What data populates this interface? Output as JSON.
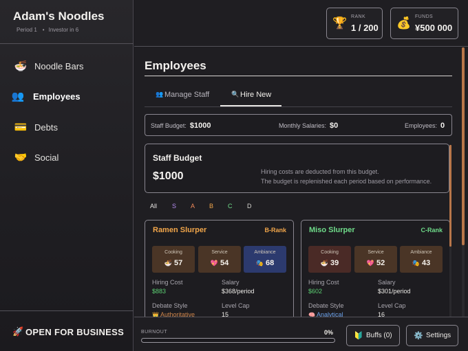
{
  "app": {
    "title": "Adam's Noodles",
    "period": "Period 1",
    "investor": "Investor in 6"
  },
  "sidebar": {
    "items": [
      {
        "label": "Noodle Bars",
        "icon": "noodle-bowl-icon",
        "glyph": "🍜"
      },
      {
        "label": "Employees",
        "icon": "people-icon",
        "glyph": "👥",
        "active": true
      },
      {
        "label": "Debts",
        "icon": "credit-card-icon",
        "glyph": "💳"
      },
      {
        "label": "Social",
        "icon": "handshake-icon",
        "glyph": "🤝"
      }
    ],
    "open_button": {
      "label": "OPEN FOR BUSINESS",
      "icon": "rocket-icon",
      "glyph": "🚀"
    }
  },
  "topbar": {
    "rank": {
      "caption": "RANK",
      "value": "1 / 200",
      "icon": "trophy-icon",
      "glyph": "🏆"
    },
    "funds": {
      "caption": "FUNDS",
      "value": "¥500 000",
      "icon": "money-bag-icon",
      "glyph": "💰"
    }
  },
  "main": {
    "title": "Employees",
    "tabs": [
      {
        "label": "Manage Staff",
        "icon": "people-icon",
        "glyph": "👥"
      },
      {
        "label": "Hire New",
        "icon": "magnifier-icon",
        "glyph": "🔍",
        "active": true
      }
    ],
    "summary": {
      "staff_budget_label": "Staff Budget:",
      "staff_budget_value": "$1000",
      "monthly_salaries_label": "Monthly Salaries:",
      "monthly_salaries_value": "$0",
      "employees_label": "Employees:",
      "employees_value": "0"
    },
    "budget_card": {
      "title": "Staff Budget",
      "amount": "$1000",
      "note_line1": "Hiring costs are deducted from this budget.",
      "note_line2": "The budget is replenished each period based on performance."
    },
    "filters": [
      {
        "label": "All",
        "color": "#e8e6e3"
      },
      {
        "label": "S",
        "color": "#b58cf0"
      },
      {
        "label": "A",
        "color": "#f08a5a"
      },
      {
        "label": "B",
        "color": "#f2a64a"
      },
      {
        "label": "C",
        "color": "#6fdc8a"
      },
      {
        "label": "D",
        "color": "#d8d6d2"
      }
    ],
    "candidates": [
      {
        "name": "Ramen Slurper",
        "name_color": "#f2a64a",
        "rank": "B-Rank",
        "rank_color": "#f2a64a",
        "skills": [
          {
            "caption": "Cooking",
            "value": "57",
            "glyph": "🍜",
            "icon": "noodle-bowl-icon",
            "bg": "#4a3526"
          },
          {
            "caption": "Service",
            "value": "54",
            "glyph": "💖",
            "icon": "heart-icon",
            "bg": "#4a3526"
          },
          {
            "caption": "Ambiance",
            "value": "68",
            "glyph": "🎭",
            "icon": "theater-masks-icon",
            "bg": "#2c3a6e"
          }
        ],
        "hiring_cost_label": "Hiring Cost",
        "hiring_cost": "$883",
        "salary_label": "Salary",
        "salary": "$368/period",
        "debate_label": "Debate Style",
        "debate_style": "Authoritative",
        "debate_glyph": "👑",
        "debate_color": "#d0864a",
        "level_cap_label": "Level Cap",
        "level_cap": "15"
      },
      {
        "name": "Miso Slurper",
        "name_color": "#6fdc8a",
        "rank": "C-Rank",
        "rank_color": "#6fdc8a",
        "skills": [
          {
            "caption": "Cooking",
            "value": "39",
            "glyph": "🍜",
            "icon": "noodle-bowl-icon",
            "bg": "#4a2a26"
          },
          {
            "caption": "Service",
            "value": "52",
            "glyph": "💖",
            "icon": "heart-icon",
            "bg": "#4a3526"
          },
          {
            "caption": "Ambiance",
            "value": "43",
            "glyph": "🎭",
            "icon": "theater-masks-icon",
            "bg": "#4a3526"
          }
        ],
        "hiring_cost_label": "Hiring Cost",
        "hiring_cost": "$602",
        "salary_label": "Salary",
        "salary": "$301/period",
        "debate_label": "Debate Style",
        "debate_style": "Analytical",
        "debate_glyph": "🧠",
        "debate_color": "#6aa0e8",
        "level_cap_label": "Level Cap",
        "level_cap": "16"
      }
    ]
  },
  "bottombar": {
    "burnout_label": "BURNOUT",
    "burnout_value": "0%",
    "burnout_fraction": 0,
    "buffs_label": "Buffs (0)",
    "buffs_glyph": "🔰",
    "settings_label": "Settings",
    "settings_glyph": "⚙️"
  }
}
